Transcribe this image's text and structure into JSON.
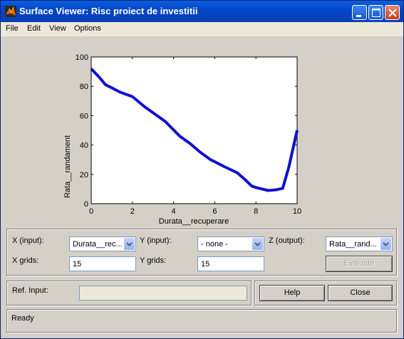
{
  "window": {
    "title": "Surface Viewer: Risc proiect de investitii"
  },
  "menu": [
    "File",
    "Edit",
    "View",
    "Options"
  ],
  "chart_data": {
    "type": "line",
    "xlabel": "Durata__recuperare",
    "ylabel": "Rata__randament",
    "xlim": [
      0,
      10
    ],
    "ylim": [
      0,
      100
    ],
    "xticks": [
      "0",
      "2",
      "4",
      "6",
      "8",
      "10"
    ],
    "yticks": [
      "0",
      "20",
      "40",
      "60",
      "80",
      "100"
    ],
    "series": [
      {
        "color": "#1010d0",
        "x": [
          0,
          0.4,
          0.7,
          1.0,
          1.4,
          2.0,
          2.6,
          3.2,
          3.6,
          4.3,
          4.8,
          5.3,
          5.8,
          6.5,
          7.1,
          7.5,
          7.8,
          8.0,
          8.6,
          9.0,
          9.3,
          9.6,
          10.0
        ],
        "y": [
          92,
          86,
          81,
          79,
          76,
          73,
          66,
          60,
          56,
          46,
          41,
          35,
          30,
          25,
          21,
          16,
          12,
          11,
          9,
          9.5,
          10.5,
          25,
          50
        ]
      }
    ]
  },
  "controls": {
    "x_input_label": "X (input):",
    "x_input_value": "Durata__rec...",
    "y_input_label": "Y (input):",
    "y_input_value": "- none -",
    "z_output_label": "Z (output):",
    "z_output_value": "Rata__rand...",
    "x_grids_label": "X grids:",
    "x_grids_value": "15",
    "y_grids_label": "Y grids:",
    "y_grids_value": "15",
    "evaluate_label": "Evaluate",
    "ref_input_label": "Ref. Input:",
    "ref_input_value": "",
    "help_label": "Help",
    "close_label": "Close",
    "status": "Ready"
  }
}
